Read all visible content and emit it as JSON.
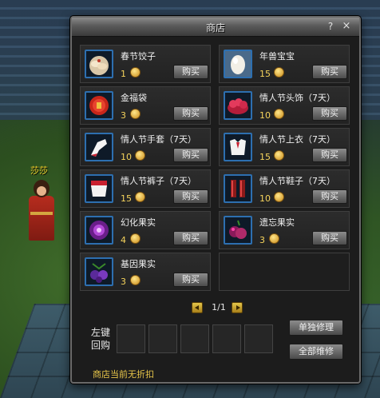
{
  "scene": {
    "npc_name": "莎莎"
  },
  "shop": {
    "title": "商店",
    "help_glyph": "?",
    "close_glyph": "×",
    "items": [
      {
        "name": "春节饺子",
        "price": "1",
        "buy_label": "购买",
        "icon": "dumplings-icon"
      },
      {
        "name": "年兽宝宝",
        "price": "15",
        "buy_label": "购买",
        "icon": "egg-icon"
      },
      {
        "name": "金福袋",
        "price": "3",
        "buy_label": "购买",
        "icon": "lucky-bag-icon"
      },
      {
        "name": "情人节头饰（7天）",
        "price": "10",
        "buy_label": "购买",
        "icon": "headwear-icon"
      },
      {
        "name": "情人节手套（7天）",
        "price": "10",
        "buy_label": "购买",
        "icon": "glove-icon"
      },
      {
        "name": "情人节上衣（7天）",
        "price": "15",
        "buy_label": "购买",
        "icon": "top-icon"
      },
      {
        "name": "情人节裤子（7天）",
        "price": "15",
        "buy_label": "购买",
        "icon": "pants-icon"
      },
      {
        "name": "情人节鞋子（7天）",
        "price": "10",
        "buy_label": "购买",
        "icon": "shoes-icon"
      },
      {
        "name": "幻化果实",
        "price": "4",
        "buy_label": "购买",
        "icon": "purple-fruit-icon"
      },
      {
        "name": "遗忘果实",
        "price": "3",
        "buy_label": "购买",
        "icon": "grape-icon"
      },
      {
        "name": "基因果实",
        "price": "3",
        "buy_label": "购买",
        "icon": "berry-icon"
      }
    ],
    "pager": {
      "text": "1/1"
    },
    "buyback_label": "左键回购",
    "repair_single": "单独修理",
    "repair_all": "全部维修",
    "status": "商店当前无折扣",
    "colors": {
      "icon_border": "#2d6fb0",
      "price": "#f5d35c",
      "status": "#e8c64a"
    }
  }
}
